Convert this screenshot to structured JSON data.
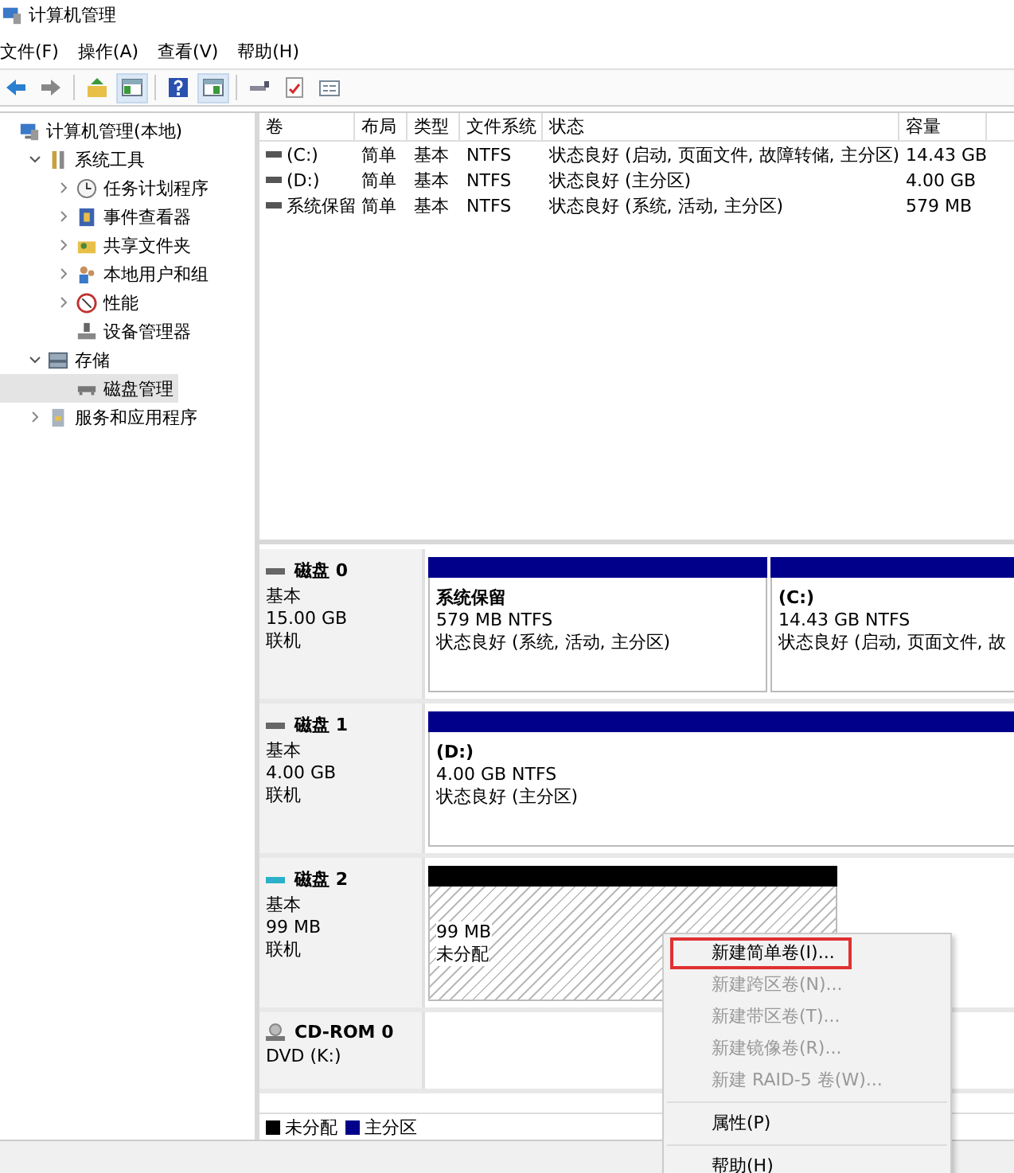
{
  "window": {
    "title": "计算机管理"
  },
  "menu": [
    "文件(F)",
    "操作(A)",
    "查看(V)",
    "帮助(H)"
  ],
  "toolbar": [
    {
      "selected": false
    },
    {
      "selected": false
    },
    {
      "selected": false
    },
    {
      "selected": true
    },
    {
      "selected": false
    },
    {
      "selected": true
    },
    {
      "selected": false
    },
    {
      "selected": false
    },
    {
      "selected": false
    }
  ],
  "tree": [
    {
      "label": "计算机管理(本地)",
      "selected": false,
      "children": [
        {
          "label": "系统工具",
          "expanded": true,
          "selected": false,
          "children": [
            {
              "label": "任务计划程序",
              "expanded": false,
              "selected": false
            },
            {
              "label": "事件查看器",
              "expanded": false,
              "selected": false
            },
            {
              "label": "共享文件夹",
              "expanded": false,
              "selected": false
            },
            {
              "label": "本地用户和组",
              "expanded": false,
              "selected": false
            },
            {
              "label": "性能",
              "expanded": false,
              "selected": false
            },
            {
              "label": "设备管理器",
              "selected": false
            }
          ]
        },
        {
          "label": "存储",
          "expanded": true,
          "selected": false,
          "children": [
            {
              "label": "磁盘管理",
              "selected": true
            }
          ]
        },
        {
          "label": "服务和应用程序",
          "expanded": false,
          "selected": false
        }
      ]
    }
  ],
  "volumes": {
    "columns": [
      "卷",
      "布局",
      "类型",
      "文件系统",
      "状态",
      "容量"
    ],
    "rows": [
      [
        "(C:)",
        "简单",
        "基本",
        "NTFS",
        "状态良好 (启动, 页面文件, 故障转储, 主分区)",
        "14.43 GB"
      ],
      [
        "(D:)",
        "简单",
        "基本",
        "NTFS",
        "状态良好 (主分区)",
        "4.00 GB"
      ],
      [
        "系统保留",
        "简单",
        "基本",
        "NTFS",
        "状态良好 (系统, 活动, 主分区)",
        "579 MB"
      ]
    ]
  },
  "disks": [
    {
      "kind": "disk",
      "name": "磁盘 0",
      "type": "基本",
      "size": "15.00 GB",
      "status": "联机",
      "partitions": [
        {
          "kind": "primary",
          "name": "系统保留",
          "size_fs": "579 MB NTFS",
          "status": "状态良好 (系统, 活动, 主分区)"
        },
        {
          "kind": "primary",
          "name": "(C:)",
          "size_fs": "14.43 GB NTFS",
          "status": "状态良好 (启动, 页面文件, 故"
        }
      ]
    },
    {
      "kind": "disk",
      "name": "磁盘 1",
      "type": "基本",
      "size": "4.00 GB",
      "status": "联机",
      "partitions": [
        {
          "kind": "primary",
          "name": "(D:)",
          "size_fs": "4.00 GB NTFS",
          "status": "状态良好 (主分区)"
        }
      ]
    },
    {
      "kind": "newdisk",
      "name": "磁盘 2",
      "type": "基本",
      "size": "99 MB",
      "status": "联机",
      "partitions": [
        {
          "kind": "unallocated",
          "size_fs": "99 MB",
          "status": "未分配"
        }
      ]
    },
    {
      "kind": "cdrom",
      "name": "CD-ROM 0",
      "type": "DVD (K:)"
    }
  ],
  "legend": [
    {
      "label": "未分配",
      "color": "#000000"
    },
    {
      "label": "主分区",
      "color": "#00008b"
    }
  ],
  "context_menu": [
    {
      "kind": "item",
      "label": "新建简单卷(I)...",
      "disabled": false,
      "highlighted": true
    },
    {
      "kind": "item",
      "label": "新建跨区卷(N)...",
      "disabled": true,
      "highlighted": false
    },
    {
      "kind": "item",
      "label": "新建带区卷(T)...",
      "disabled": true,
      "highlighted": false
    },
    {
      "kind": "item",
      "label": "新建镜像卷(R)...",
      "disabled": true,
      "highlighted": false
    },
    {
      "kind": "item",
      "label": "新建 RAID-5 卷(W)...",
      "disabled": true,
      "highlighted": false
    },
    {
      "kind": "separator"
    },
    {
      "kind": "item",
      "label": "属性(P)",
      "disabled": false,
      "highlighted": false
    },
    {
      "kind": "separator"
    },
    {
      "kind": "item",
      "label": "帮助(H)",
      "disabled": false,
      "highlighted": false
    }
  ]
}
